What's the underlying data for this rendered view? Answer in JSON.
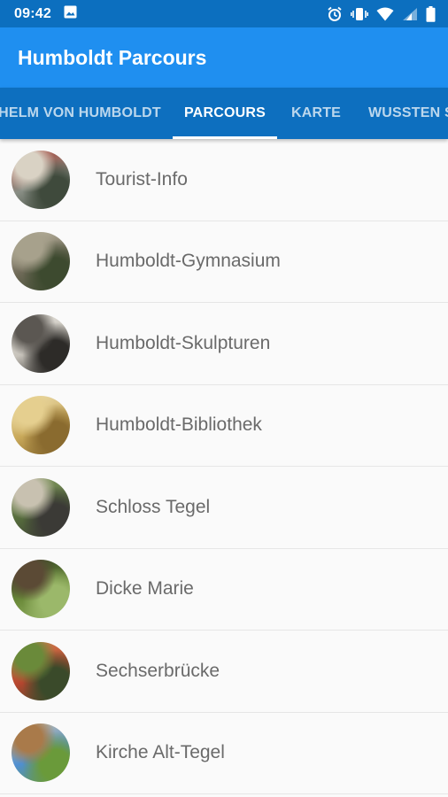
{
  "status_bar": {
    "time": "09:42",
    "icons": [
      "image-icon",
      "alarm-icon",
      "vibrate-icon",
      "wifi-icon",
      "signal-icon",
      "battery-icon"
    ]
  },
  "app_bar": {
    "title": "Humboldt Parcours"
  },
  "tabs": [
    {
      "label": "HELM VON HUMBOLDT",
      "active": false
    },
    {
      "label": "PARCOURS",
      "active": true
    },
    {
      "label": "KARTE",
      "active": false
    },
    {
      "label": "WUSSTEN S",
      "active": false
    }
  ],
  "items": [
    {
      "label": "Tourist-Info",
      "thumb_colors": [
        "#8a8f86",
        "#d9d2c4",
        "#3f4a3c",
        "#b23a2e"
      ]
    },
    {
      "label": "Humboldt-Gymnasium",
      "thumb_colors": [
        "#6f6a58",
        "#a7a18c",
        "#3d4a2f",
        "#c9c2ad"
      ]
    },
    {
      "label": "Humboldt-Skulpturen",
      "thumb_colors": [
        "#c7c3bb",
        "#5b5752",
        "#2d2b28",
        "#e6e3dc"
      ]
    },
    {
      "label": "Humboldt-Bibliothek",
      "thumb_colors": [
        "#c9a95a",
        "#e5cf8f",
        "#8a6b2f",
        "#f1e4b8"
      ]
    },
    {
      "label": "Schloss Tegel",
      "thumb_colors": [
        "#556b3c",
        "#c8c1b0",
        "#3b3a36",
        "#8fa46a"
      ]
    },
    {
      "label": "Dicke Marie",
      "thumb_colors": [
        "#6b8a3a",
        "#5b4a35",
        "#9bb86a",
        "#2e3b22"
      ]
    },
    {
      "label": "Sechserbrücke",
      "thumb_colors": [
        "#b7462f",
        "#6a8a3a",
        "#3a4a2a",
        "#d98a55"
      ]
    },
    {
      "label": "Kirche Alt-Tegel",
      "thumb_colors": [
        "#4f8fd1",
        "#a97a4a",
        "#6a9a3a",
        "#d9c7a6"
      ]
    }
  ]
}
